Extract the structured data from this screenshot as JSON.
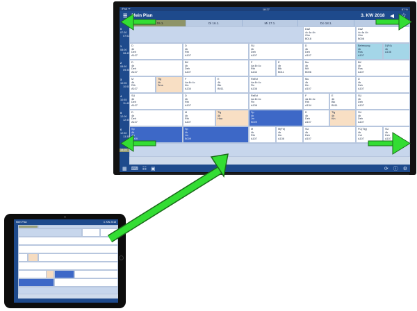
{
  "status": {
    "left": "iPad ᯤ",
    "time": "18:27",
    "right": "87 %"
  },
  "app": {
    "title": "Mein Plan",
    "week": "3. KW 2018"
  },
  "days": [
    "Mo 15.1.",
    "Di 16.1.",
    "Mi 17.1.",
    "Do 18.1.",
    "Fr 19.1."
  ],
  "periods": [
    {
      "num": "0",
      "from": "07:30",
      "to": "07:52"
    },
    {
      "num": "1",
      "from": "08:00",
      "to": "08:45"
    },
    {
      "num": "2",
      "from": "08:50",
      "to": "09:35"
    },
    {
      "num": "3",
      "from": "10:05",
      "to": "10:50"
    },
    {
      "num": "4",
      "from": "10:55",
      "to": "11:40"
    },
    {
      "num": "5",
      "from": "12:00",
      "to": "12:45"
    },
    {
      "num": "6",
      "from": "12:50",
      "to": "13:35"
    },
    {
      "num": "",
      "from": "14:25",
      "to": ""
    }
  ],
  "lessons": {
    "p0_fri": [
      "DaZ",
      "4c 4a 4b",
      "Gim",
      "B008"
    ],
    "p0_thu": [
      "DaZ",
      "4c 4a 4b",
      "Gim",
      "B018"
    ],
    "p1_mon": [
      "D",
      "4b",
      "Deh",
      "A107"
    ],
    "p1_tue": [
      "D",
      "4b",
      "Rth",
      "A107"
    ],
    "p1_wed": [
      "SU",
      "4b",
      "Deh",
      "A107"
    ],
    "p1_thu": [
      "D",
      "4b",
      "Deh",
      "A107"
    ],
    "p1_fri_a": [
      "Betreuung",
      "4b",
      "Ros",
      "A107"
    ],
    "p1_fri_b": [
      "D(Fö)",
      "4b",
      "A136"
    ],
    "p2_mon": [
      "D",
      "4b",
      "Deh",
      "A107"
    ],
    "p2_tue": [
      "BK",
      "4b",
      "Deh",
      "A107"
    ],
    "p2_wed_a": [
      "F",
      "4a 4b 4c",
      "Rth",
      "A134"
    ],
    "p2_wed_b": [
      "E",
      "4b",
      "Blk",
      "B011"
    ],
    "p2_thu": [
      "Mu",
      "4b",
      "Mlt",
      "B006"
    ],
    "p2_fri": [
      "BK",
      "4b",
      "Ros",
      "A107"
    ],
    "p3_mon_a": [
      "M",
      "4b",
      "Rth",
      "A107"
    ],
    "p3_mon_b": [
      "Tlg",
      "4b",
      "Sms"
    ],
    "p3_tue_a": [
      "F",
      "4a 4b 4c",
      "Kin",
      "A134"
    ],
    "p3_tue_b": [
      "E",
      "4b",
      "Blk",
      "B011"
    ],
    "p3_wed": [
      "ReEvl",
      "4a 4b 4c",
      "Fin",
      "A136"
    ],
    "p3_thu": [
      "Mu",
      "4b",
      "Kin",
      "A107"
    ],
    "p3_fri": [
      "D",
      "4b",
      "Deh",
      "A107"
    ],
    "p4_mon": [
      "SU",
      "4b",
      "Deh",
      "A107"
    ],
    "p4_tue": [
      "D",
      "4b",
      "Rth",
      "A107"
    ],
    "p4_wed": [
      "ReEvl",
      "4a 4b 4c",
      "Fin",
      "A136"
    ],
    "p4_thu_a": [
      "F",
      "4a 4b 4c",
      "Rth",
      "A134"
    ],
    "p4_thu_b": [
      "E",
      "4b",
      "Blk",
      "B011"
    ],
    "p4_fri": [
      "SU",
      "4b",
      "Deh",
      "A107"
    ],
    "p5_mon": [
      "D",
      "4b",
      "Deh",
      "A107"
    ],
    "p5_tue_a": [
      "M",
      "4b",
      "Rth",
      "A107"
    ],
    "p5_tue_b": [
      "Tlg",
      "4b",
      "Haa"
    ],
    "p5_wed": [
      "Sp",
      "4b",
      "Jrn",
      "B009"
    ],
    "p5_thu_a": [
      "D",
      "4b",
      "Deh",
      "A107"
    ],
    "p5_thu_b": [
      "Tlg",
      "4b",
      "Kin"
    ],
    "p5_fri": [
      "SU",
      "4b",
      "Deh",
      "A107"
    ],
    "p6_mon": [
      "Sp",
      "4b",
      "Jrn",
      "B009"
    ],
    "p6_tue": [
      "Sp",
      "4b",
      "Jrn",
      "B009"
    ],
    "p6_wed_a": [
      "M",
      "4b",
      "Rth",
      "A107"
    ],
    "p6_wed_b": [
      "M(Fö)",
      "4b",
      "Kin",
      "A136"
    ],
    "p6_thu": [
      "SU",
      "4b",
      "Deh",
      "A107"
    ],
    "p6_fri_a": [
      "FC(Tlg)",
      "4b",
      "Col",
      "A107"
    ],
    "p6_fri_b": [
      "SU",
      "4b",
      "Deh",
      "A107"
    ]
  },
  "tablet": {
    "title": "Mein Plan",
    "week": "3. KW 2018"
  },
  "toolbar_icons": [
    "grid-icon",
    "keyboard-icon",
    "list-icon",
    "image-icon",
    "refresh-icon",
    "info-icon",
    "settings-icon"
  ],
  "colors": {
    "accent": "#1e4a8c",
    "highlight": "#3d68c7",
    "arrow": "#33dd33"
  }
}
